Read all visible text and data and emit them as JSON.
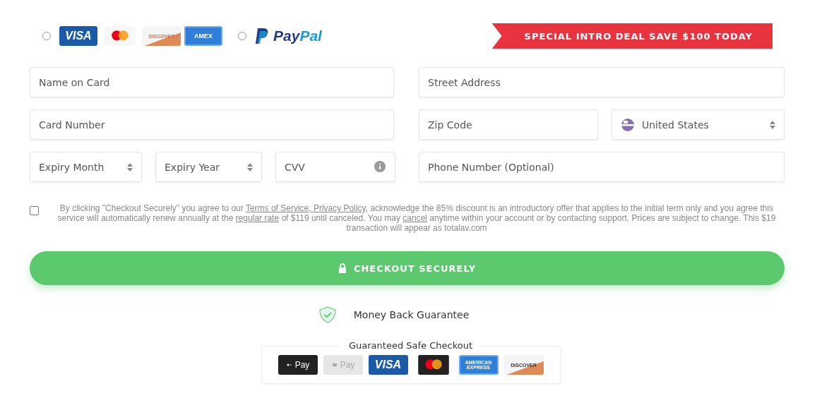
{
  "payment_methods": [
    {
      "selected": false,
      "logos": [
        {
          "kind": "visa",
          "text": "VISA"
        },
        {
          "kind": "mastercard"
        },
        {
          "kind": "discover",
          "text": "DISCOVER"
        },
        {
          "kind": "amex",
          "text": "AMEX"
        }
      ]
    },
    {
      "selected": false,
      "logos": [
        {
          "kind": "paypal",
          "text": "PayPal"
        }
      ]
    }
  ],
  "promo_banner": "SPECIAL INTRO DEAL SAVE $100 TODAY",
  "fields": {
    "name_on_card": {
      "placeholder": "Name on Card"
    },
    "street_address": {
      "placeholder": "Street Address"
    },
    "card_number": {
      "placeholder": "Card Number"
    },
    "zip_code": {
      "placeholder": "Zip Code"
    },
    "country": {
      "value": "United States"
    },
    "expiry_month": {
      "value": "Expiry Month"
    },
    "expiry_year": {
      "value": "Expiry Year"
    },
    "cvv": {
      "placeholder": "CVV"
    },
    "phone": {
      "placeholder": "Phone Number (Optional)"
    }
  },
  "terms": {
    "checked": false,
    "segments": [
      {
        "kind": "text",
        "text": "By clicking \"Checkout Securely\" you agree to our "
      },
      {
        "kind": "link",
        "text": "Terms of Service, Privacy Policy"
      },
      {
        "kind": "text",
        "text": ", acknowledge the 85% discount is an introductory offer that applies to the initial term only and you agree this service will automatically renew annually at the "
      },
      {
        "kind": "link",
        "text": "regular rate"
      },
      {
        "kind": "text",
        "text": " of $119 until canceled. You may "
      },
      {
        "kind": "link",
        "text": "cancel"
      },
      {
        "kind": "text",
        "text": " anytime within your account or by contacting support. Prices are subject to change. This $19 transaction will appear as totalav.com"
      }
    ]
  },
  "checkout_button": "CHECKOUT SECURELY",
  "guarantee": "Money Back Guarantee",
  "safe_checkout": {
    "title": "Guaranteed Safe Checkout",
    "badges": [
      {
        "kind": "applepay",
        "text": "Pay"
      },
      {
        "kind": "googlepay",
        "text": "Pay"
      },
      {
        "kind": "visa",
        "text": "VISA"
      },
      {
        "kind": "mastercard"
      },
      {
        "kind": "amex",
        "text": "AMERICAN EXPRESS"
      },
      {
        "kind": "discover",
        "text": "DISCOVER"
      }
    ]
  }
}
